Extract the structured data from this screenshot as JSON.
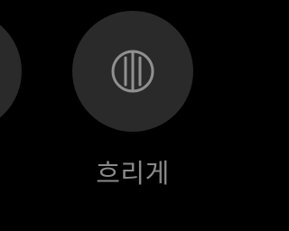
{
  "colors": {
    "background": "#000000",
    "button_fill": "#2a2a2a",
    "icon_stroke": "#909090",
    "label": "#8a8a8a"
  },
  "options": {
    "previous": {
      "icon": "unknown-option-icon"
    },
    "current": {
      "icon": "blur-transparency-icon",
      "label": "흐리게"
    }
  }
}
